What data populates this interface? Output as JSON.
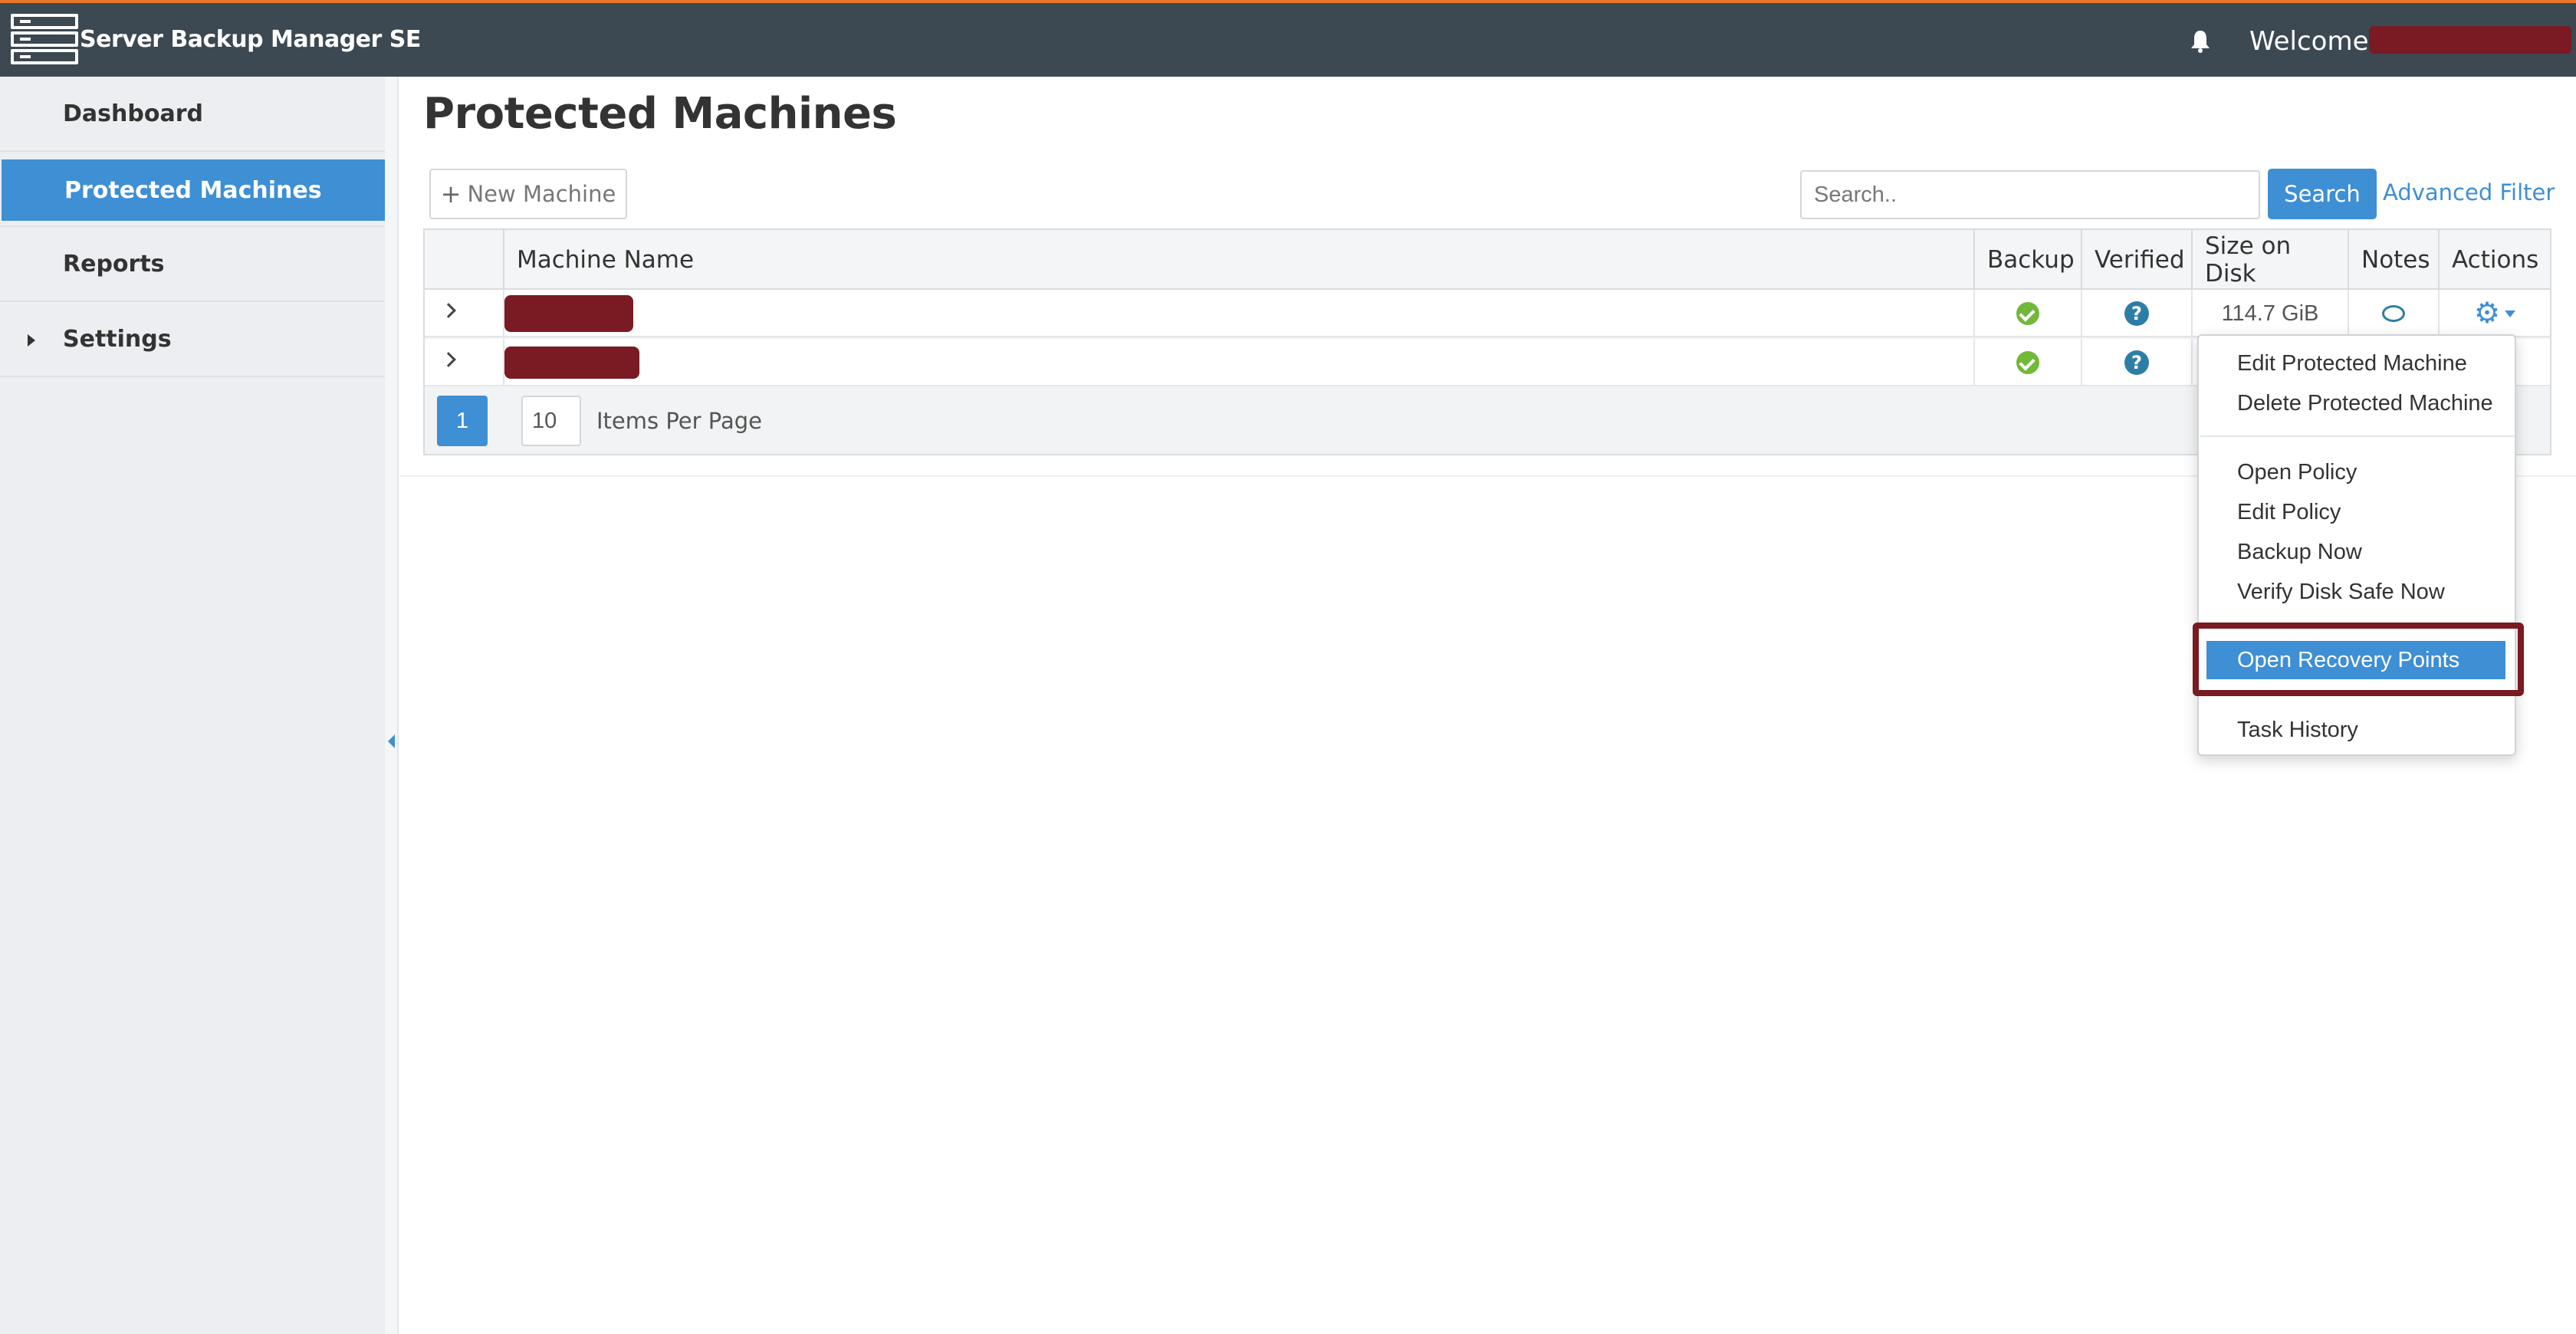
{
  "app": {
    "title": "Server Backup Manager SE",
    "welcome": "Welcome,"
  },
  "sidebar": {
    "items": [
      {
        "label": "Dashboard"
      },
      {
        "label": "Protected Machines"
      },
      {
        "label": "Reports"
      },
      {
        "label": "Settings"
      }
    ]
  },
  "page": {
    "title": "Protected Machines"
  },
  "toolbar": {
    "new_machine": "New Machine",
    "search_placeholder": "Search..",
    "search_button": "Search",
    "advanced_filter": "Advanced Filter"
  },
  "table": {
    "columns": [
      "Machine Name",
      "Backup",
      "Verified",
      "Size on Disk",
      "Notes",
      "Actions"
    ],
    "rows": [
      {
        "size": "114.7 GiB"
      },
      {
        "size": ""
      }
    ]
  },
  "pager": {
    "page": "1",
    "per_page": "10",
    "per_page_label": "Items Per Page"
  },
  "menu": {
    "items": [
      "Edit Protected Machine",
      "Delete Protected Machine",
      "Open Policy",
      "Edit Policy",
      "Backup Now",
      "Verify Disk Safe Now",
      "Open Recovery Points",
      "Task History"
    ]
  },
  "colors": {
    "accent": "#3e8fd4",
    "topbar": "#3c4852",
    "topbar_border": "#e8762b",
    "redaction": "#7a1a22"
  },
  "icons": [
    "server-icon",
    "bell-icon",
    "plus-icon",
    "check-circle-icon",
    "question-circle-icon",
    "comment-icon",
    "gear-icon",
    "chevron-right-icon"
  ]
}
